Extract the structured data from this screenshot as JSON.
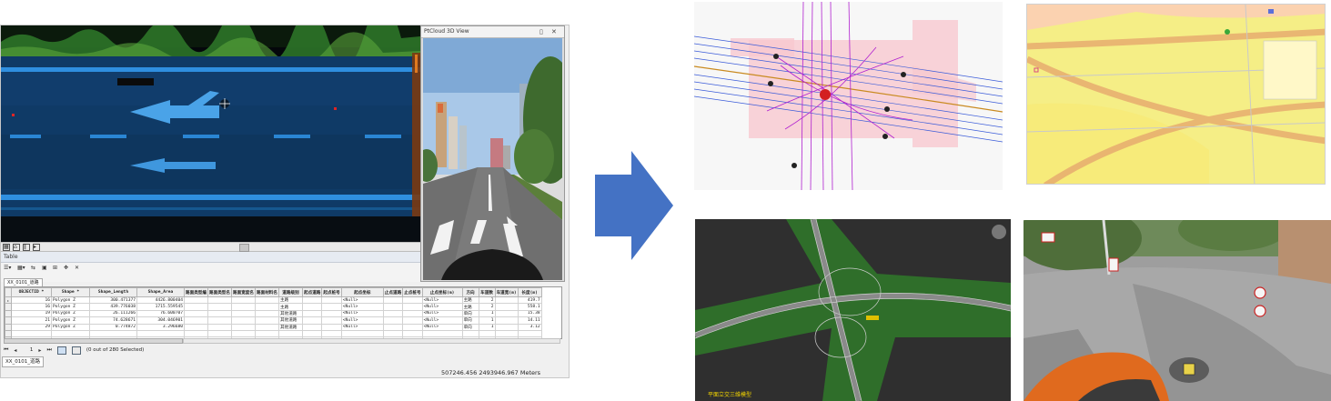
{
  "pointcloud_view": {
    "toolbar_icons": [
      "grid-icon",
      "home-icon",
      "pause-icon",
      "play-icon"
    ]
  },
  "view3d": {
    "title": "PtCloud 3D View",
    "pin_glyph": "▯",
    "close_glyph": "✕"
  },
  "table_pane": {
    "title": "Table",
    "toolbar_glyphs": [
      "☰▾",
      "▦▾",
      "⇆",
      "▣",
      "⊞",
      "✥",
      "✕"
    ],
    "layer_tab_top": "XX_0101_道路",
    "columns": [
      "",
      "OBJECTID *",
      "Shape *",
      "Shape_Length",
      "Shape_Area",
      "路面类型编",
      "路面类型名",
      "路面宽度名",
      "路面材料名",
      "道路级别",
      "起点道路",
      "起点桩号",
      "起点坐标",
      "止点道路",
      "止点桩号",
      "止点坐标(m)",
      "方向",
      "车道数",
      "车道宽(m)",
      "长度(m)"
    ],
    "rows": [
      [
        "▸",
        "16",
        "Polygon Z",
        "300.471377",
        "4426.800404",
        "",
        "",
        "",
        "",
        "主路",
        "",
        "",
        "<Null>",
        "",
        "",
        "<Null>",
        "主路",
        "2",
        "",
        "419.7"
      ],
      [
        "",
        "16",
        "Polygon Z",
        "439.776038",
        "1715.559545",
        "",
        "",
        "",
        "",
        "主路",
        "",
        "",
        "<Null>",
        "",
        "",
        "<Null>",
        "主路",
        "2",
        "",
        "558.1"
      ],
      [
        "",
        "19",
        "Polygon Z",
        "26.111266",
        "76.600707",
        "",
        "",
        "",
        "",
        "其他道路",
        "",
        "",
        "<Null>",
        "",
        "",
        "<Null>",
        "单向",
        "1",
        "",
        "15.38"
      ],
      [
        "",
        "21",
        "Polygon Z",
        "74.628671",
        "304.046901",
        "",
        "",
        "",
        "",
        "其他道路",
        "",
        "",
        "<Null>",
        "",
        "",
        "<Null>",
        "单向",
        "1",
        "",
        "14.11"
      ],
      [
        "",
        "29",
        "Polygon Z",
        "0.774872",
        "3.296680",
        "",
        "",
        "",
        "",
        "其他道路",
        "",
        "",
        "<Null>",
        "",
        "",
        "<Null>",
        "单向",
        "1",
        "",
        "3.12"
      ]
    ],
    "nav": {
      "first": "⏮",
      "prev": "◂",
      "page": "1",
      "next": "▸",
      "last": "⏭"
    },
    "selection_status": "(0 out of 280 Selected)",
    "layer_tab": "XX_0101_道路"
  },
  "status_bar": {
    "coordinates": "507246.456  2493946.967 Meters"
  },
  "gallery": {
    "model_caption": "平面立交三维模型"
  }
}
